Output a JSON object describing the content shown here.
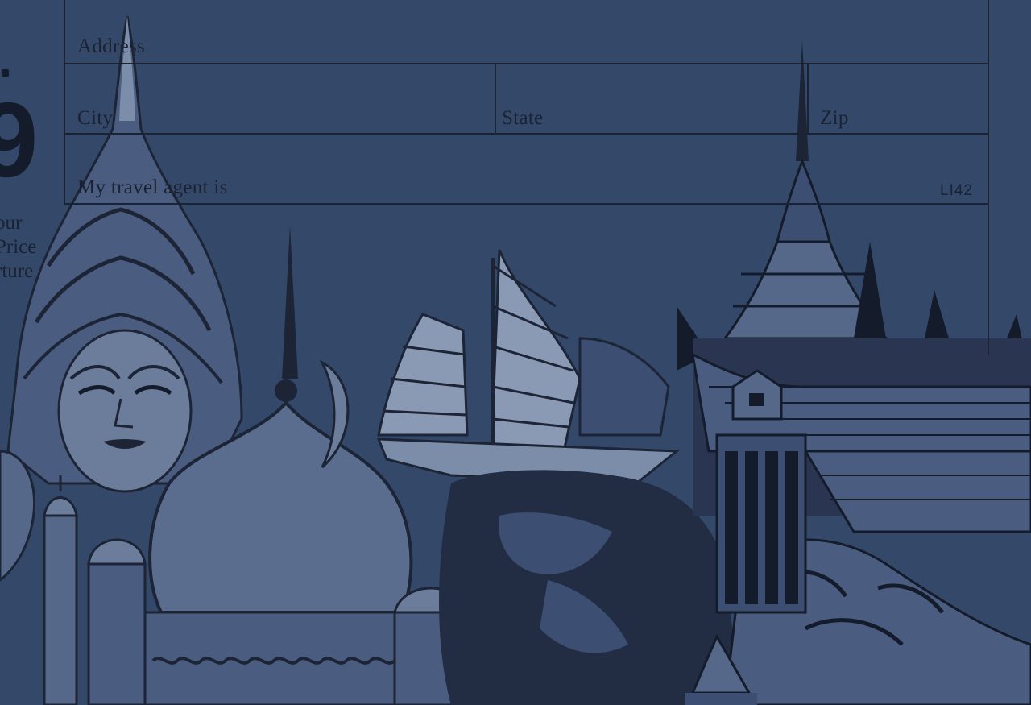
{
  "form": {
    "address_label": "Address",
    "city_label": "City",
    "state_label": "State",
    "zip_label": "Zip",
    "agent_label": "My travel agent is",
    "code": "LI42"
  },
  "side": {
    "price_digit": "9",
    "line1": "our",
    "line2": "Price",
    "line3": "rture"
  },
  "colors": {
    "background": "#34496a",
    "ink": "#1a2233",
    "illustration_light": "#6c7d9c"
  }
}
